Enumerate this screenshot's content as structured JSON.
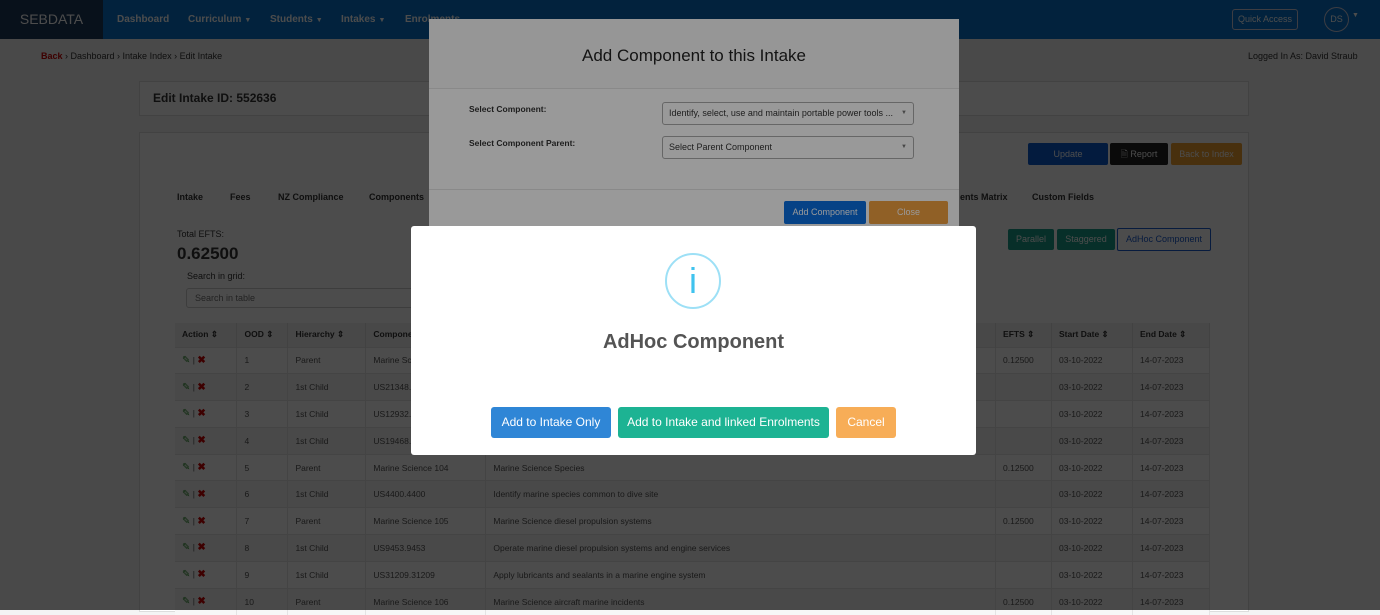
{
  "nav": {
    "brand": "SEBDATA",
    "items": [
      "Dashboard",
      "Curriculum",
      "Students",
      "Intakes",
      "Enrolments"
    ],
    "quick_access": "Quick Access",
    "avatar": "DS"
  },
  "breadcrumb": {
    "back": "Back",
    "items": [
      "Dashboard",
      "Intake Index",
      "Edit Intake"
    ]
  },
  "logged_in": "Logged In As: David Straub",
  "edit_title": "Edit Intake ID: 552636",
  "actions": {
    "update": "Update",
    "report": "Report",
    "back": "Back to Index"
  },
  "tabs": [
    "Intake",
    "Fees",
    "NZ Compliance",
    "Components",
    "ents Matrix",
    "Custom Fields"
  ],
  "component_buttons": {
    "parallel": "Parallel",
    "staggered": "Staggered",
    "adhoc": "AdHoc Component"
  },
  "efts": {
    "label": "Total EFTS:",
    "value": "0.62500"
  },
  "search": {
    "label": "Search in grid:",
    "placeholder": "Search in table"
  },
  "table": {
    "headers": [
      "Action",
      "OOD",
      "Hierarchy",
      "Compone",
      "",
      "EFTS",
      "Start Date",
      "End Date"
    ],
    "rows": [
      [
        "1",
        "Parent",
        "Marine Sc",
        "",
        "0.12500",
        "03-10-2022",
        "14-07-2023"
      ],
      [
        "2",
        "1st Child",
        "US21348.",
        "",
        "",
        "03-10-2022",
        "14-07-2023"
      ],
      [
        "3",
        "1st Child",
        "US12932.",
        "",
        "",
        "03-10-2022",
        "14-07-2023"
      ],
      [
        "4",
        "1st Child",
        "US19468.",
        "",
        "",
        "03-10-2022",
        "14-07-2023"
      ],
      [
        "5",
        "Parent",
        "Marine Science 104",
        "Marine Science Species",
        "0.12500",
        "03-10-2022",
        "14-07-2023"
      ],
      [
        "6",
        "1st Child",
        "US4400.4400",
        "Identify marine species common to dive site",
        "",
        "03-10-2022",
        "14-07-2023"
      ],
      [
        "7",
        "Parent",
        "Marine Science 105",
        "Marine Science diesel propulsion systems",
        "0.12500",
        "03-10-2022",
        "14-07-2023"
      ],
      [
        "8",
        "1st Child",
        "US9453.9453",
        "Operate marine diesel propulsion systems and engine services",
        "",
        "03-10-2022",
        "14-07-2023"
      ],
      [
        "9",
        "1st Child",
        "US31209.31209",
        "Apply lubricants and sealants in a marine engine system",
        "",
        "03-10-2022",
        "14-07-2023"
      ],
      [
        "10",
        "Parent",
        "Marine Science 106",
        "Marine Science aircraft marine incidents",
        "0.12500",
        "03-10-2022",
        "14-07-2023"
      ]
    ]
  },
  "modal1": {
    "title": "Add Component to this Intake",
    "component_label": "Select Component:",
    "component_value": "Identify, select, use and maintain portable power tools ...",
    "parent_label": "Select Component Parent:",
    "parent_value": "Select Parent Component",
    "add": "Add Component",
    "close": "Close"
  },
  "modal2": {
    "icon": "info-icon",
    "title": "AdHoc Component",
    "btn_intake": "Add to Intake Only",
    "btn_linked": "Add to Intake and linked Enrolments",
    "btn_cancel": "Cancel"
  },
  "colors": {
    "primary": "#2f86d6",
    "teal": "#1db393",
    "orange": "#f7ad57",
    "info": "#3fc3ee"
  }
}
